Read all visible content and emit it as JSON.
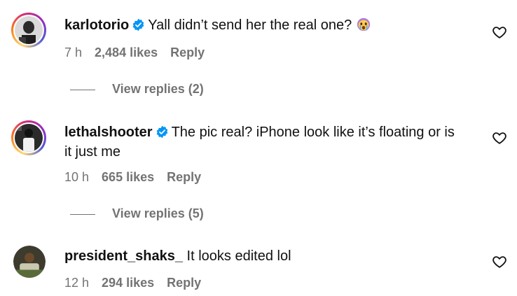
{
  "colors": {
    "muted": "#737373",
    "verified": "#0095f6",
    "text": "#111111"
  },
  "comments": [
    {
      "username": "karlotorio",
      "verified": true,
      "text": "Yall didn’t send her the real one?",
      "emoji": "crying-face-emoji",
      "time": "7 h",
      "likes": "2,484 likes",
      "reply": "Reply",
      "view_replies": "View replies (2)"
    },
    {
      "username": "lethalshooter",
      "verified": true,
      "text_line1": "The pic real? iPhone look like it’s floating or is",
      "text_line2": "it just me",
      "time": "10 h",
      "likes": "665 likes",
      "reply": "Reply",
      "view_replies": "View replies (5)"
    },
    {
      "username": "president_shaks_",
      "verified": false,
      "text": "It looks edited lol",
      "time": "12 h",
      "likes": "294 likes",
      "reply": "Reply"
    }
  ]
}
